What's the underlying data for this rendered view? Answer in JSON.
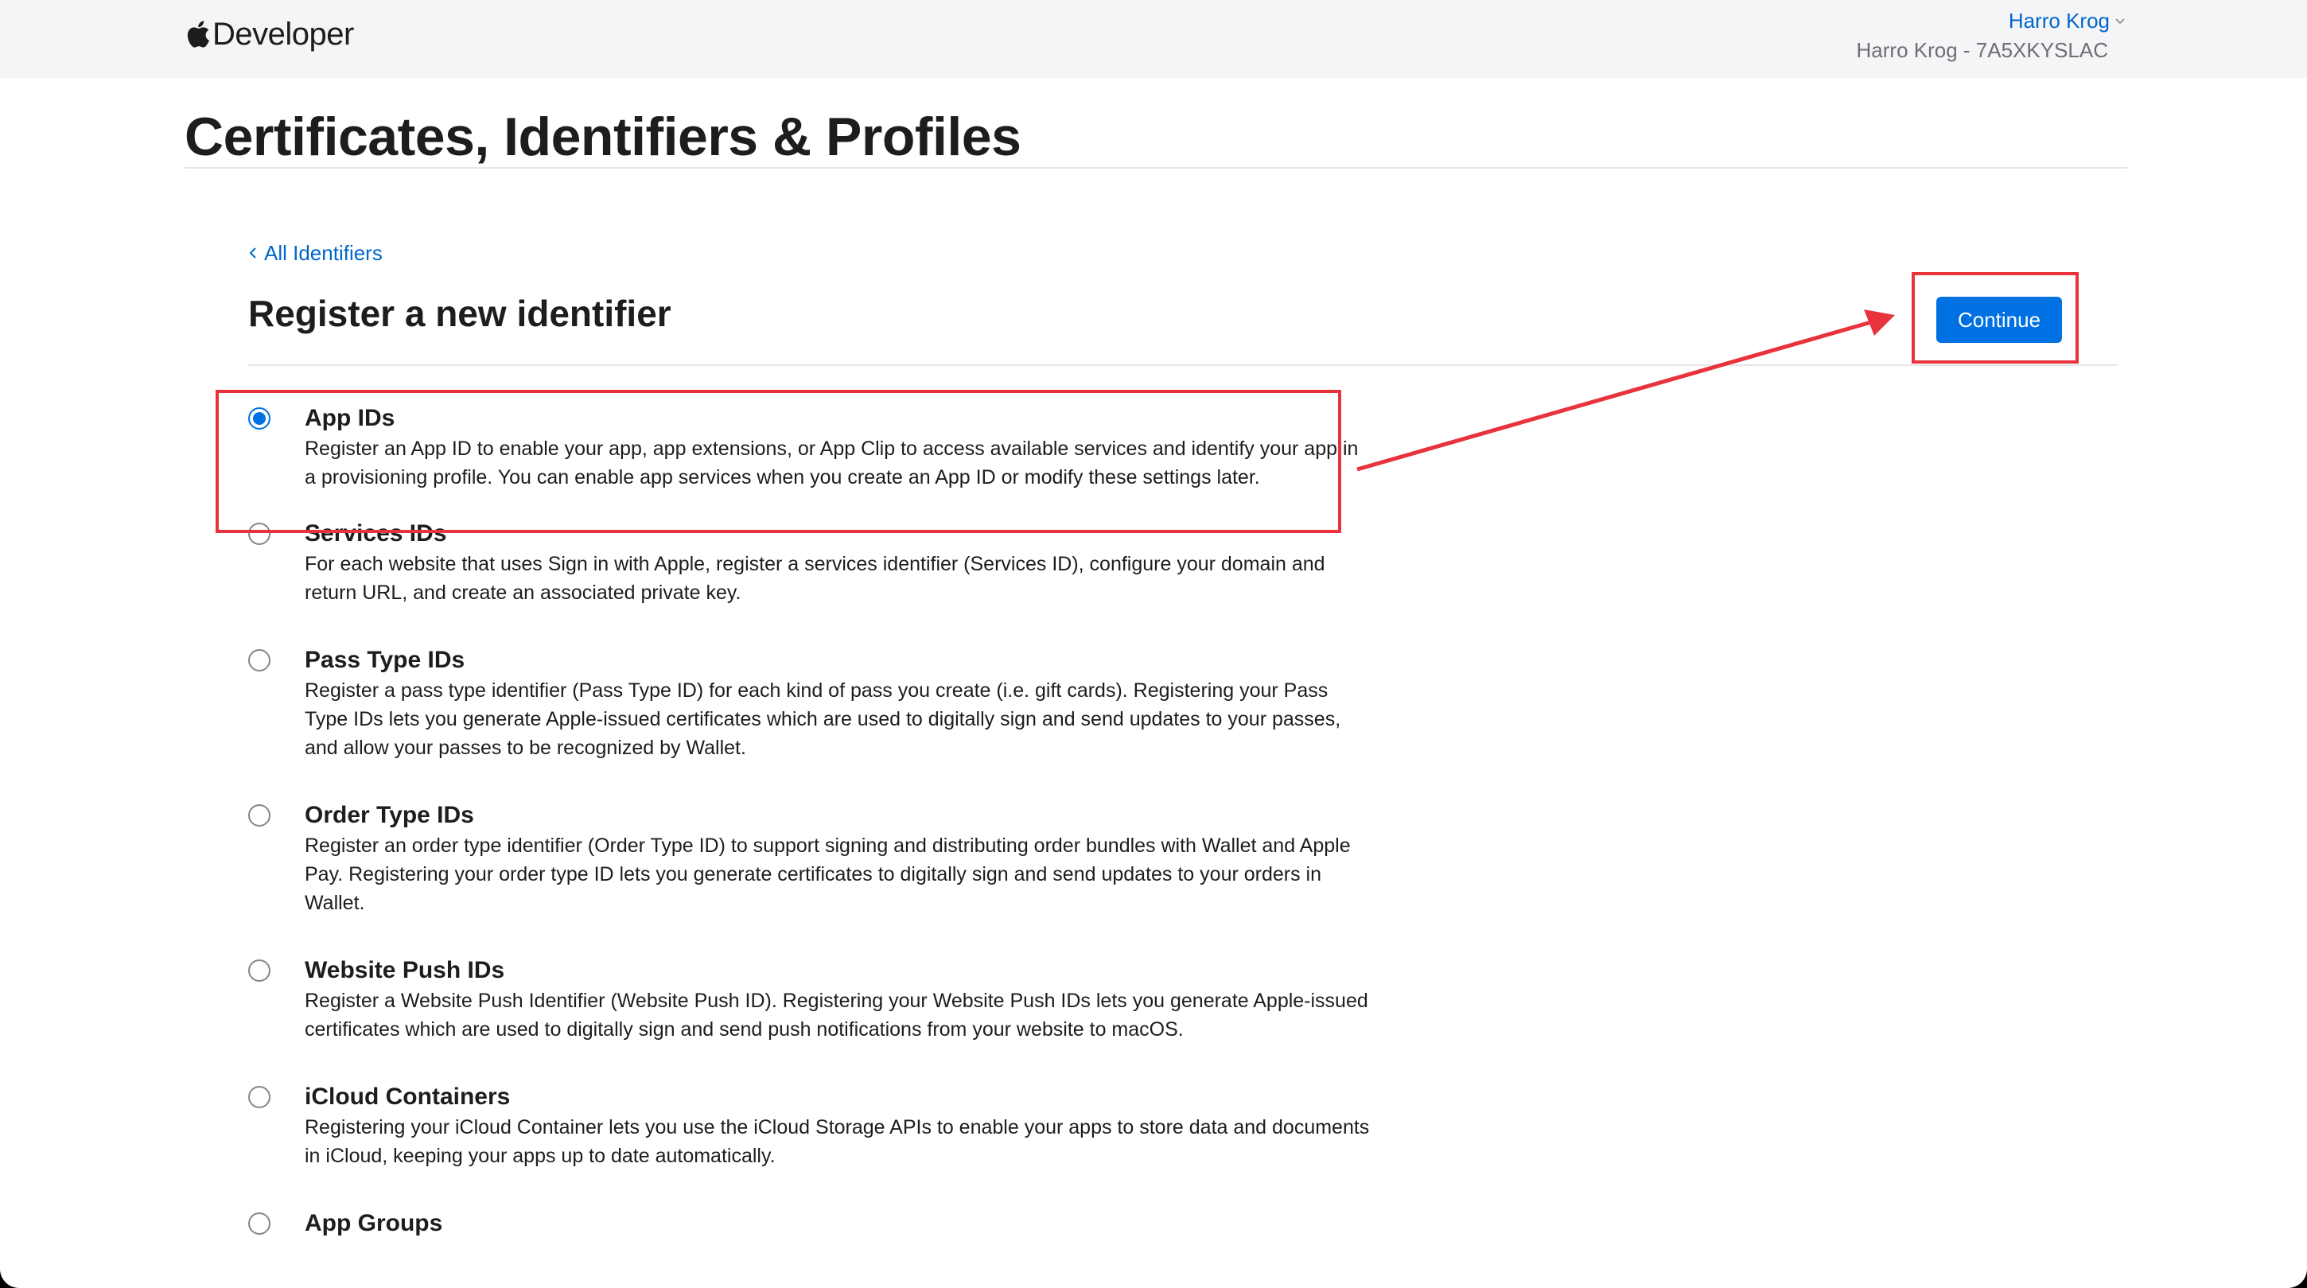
{
  "header": {
    "brand": "Developer",
    "account_name": "Harro Krog",
    "account_team": "Harro Krog - 7A5XKYSLAC"
  },
  "page": {
    "title": "Certificates, Identifiers & Profiles"
  },
  "section": {
    "back_link": "All Identifiers",
    "title": "Register a new identifier",
    "continue_label": "Continue"
  },
  "options": [
    {
      "title": "App IDs",
      "description": "Register an App ID to enable your app, app extensions, or App Clip to access available services and identify your app in a provisioning profile. You can enable app services when you create an App ID or modify these settings later.",
      "selected": true
    },
    {
      "title": "Services IDs",
      "description": "For each website that uses Sign in with Apple, register a services identifier (Services ID), configure your domain and return URL, and create an associated private key.",
      "selected": false
    },
    {
      "title": "Pass Type IDs",
      "description": "Register a pass type identifier (Pass Type ID) for each kind of pass you create (i.e. gift cards). Registering your Pass Type IDs lets you generate Apple-issued certificates which are used to digitally sign and send updates to your passes, and allow your passes to be recognized by Wallet.",
      "selected": false
    },
    {
      "title": "Order Type IDs",
      "description": "Register an order type identifier (Order Type ID) to support signing and distributing order bundles with Wallet and Apple Pay. Registering your order type ID lets you generate certificates to digitally sign and send updates to your orders in Wallet.",
      "selected": false
    },
    {
      "title": "Website Push IDs",
      "description": "Register a Website Push Identifier (Website Push ID). Registering your Website Push IDs lets you generate Apple-issued certificates which are used to digitally sign and send push notifications from your website to macOS.",
      "selected": false
    },
    {
      "title": "iCloud Containers",
      "description": "Registering your iCloud Container lets you use the iCloud Storage APIs to enable your apps to store data and documents in iCloud, keeping your apps up to date automatically.",
      "selected": false
    },
    {
      "title": "App Groups",
      "description": "",
      "selected": false
    }
  ],
  "colors": {
    "accent": "#0071e3",
    "link": "#0066cc",
    "annotation": "#e8333d"
  },
  "icons": {
    "logo": "apple-logo-icon",
    "account_chevron": "chevron-down-icon",
    "back_chevron": "chevron-left-icon"
  }
}
